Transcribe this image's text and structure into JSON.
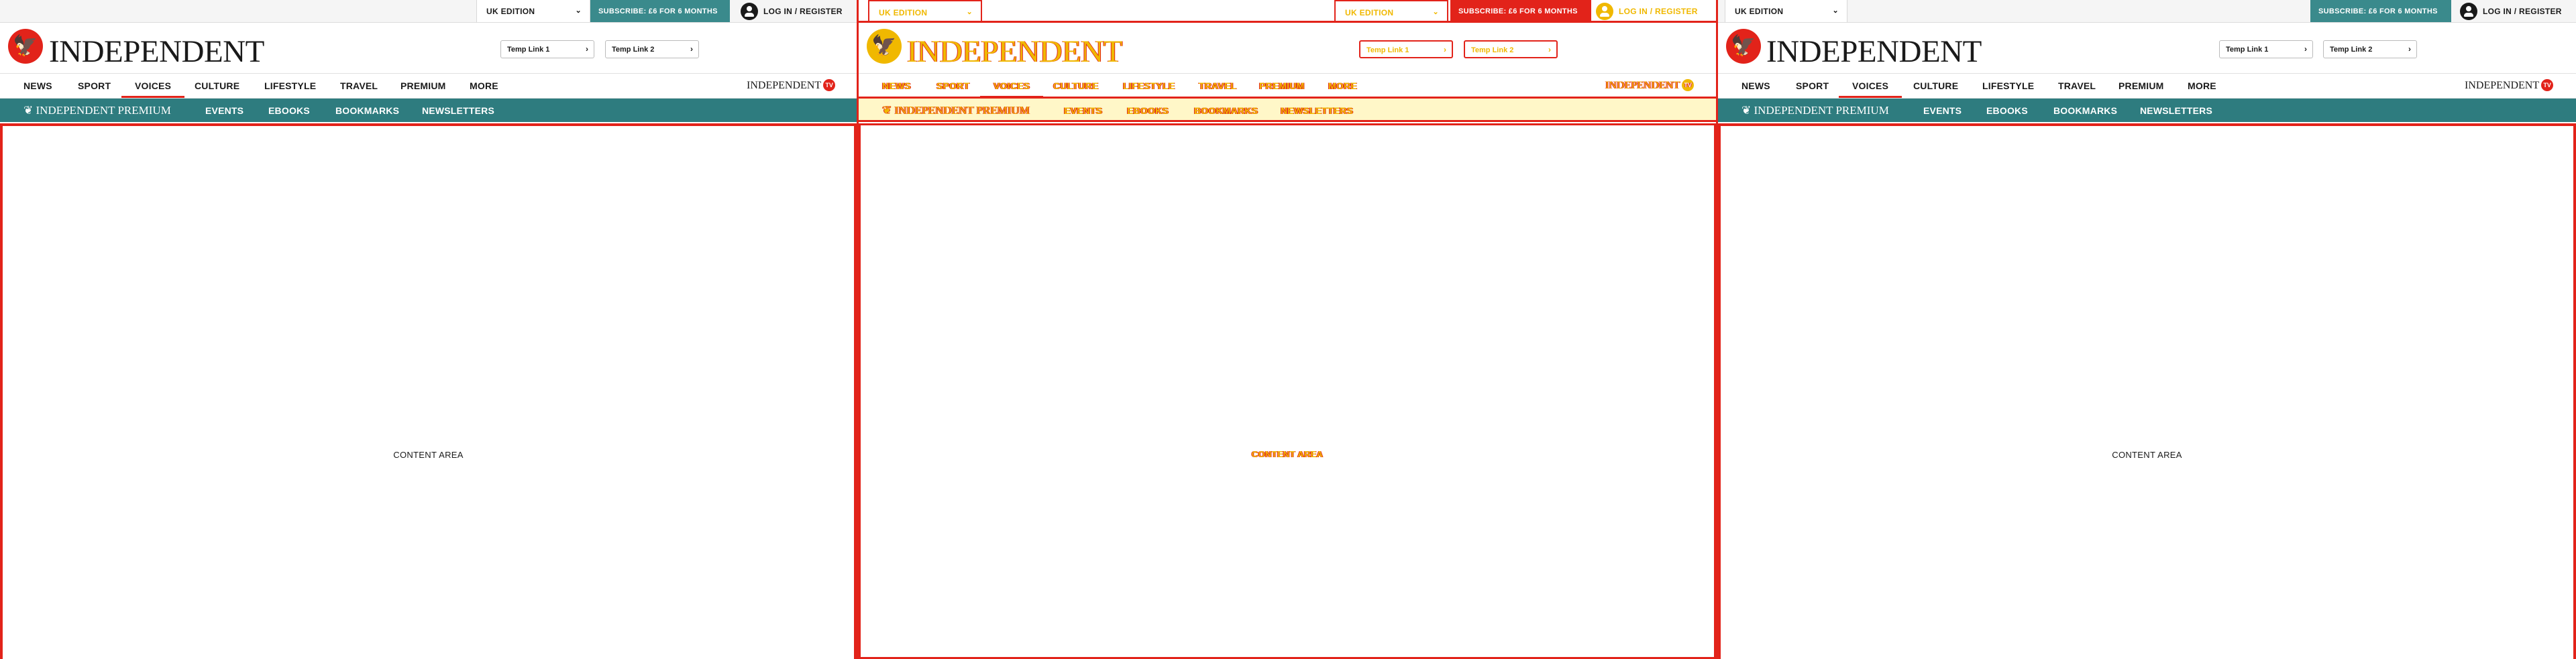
{
  "topbar": {
    "edition": "UK EDITION",
    "subscribe": "SUBSCRIBE: £6 FOR 6 MONTHS",
    "login": "LOG IN / REGISTER"
  },
  "masthead": {
    "wordmark": "INDEPENDENT",
    "temp_link_1": "Temp Link 1",
    "temp_link_2": "Temp Link 2"
  },
  "nav": {
    "items": [
      "NEWS",
      "SPORT",
      "VOICES",
      "CULTURE",
      "LIFESTYLE",
      "TRAVEL",
      "PREMIUM",
      "MORE"
    ],
    "active": "VOICES",
    "tv_logo": "INDEPENDENT",
    "tv_badge": "TV"
  },
  "premium_bar": {
    "logo": "INDEPENDENT PREMIUM",
    "items": [
      "EVENTS",
      "EBOOKS",
      "BOOKMARKS",
      "NEWSLETTERS"
    ]
  },
  "content": {
    "label": "CONTENT AREA"
  },
  "colors": {
    "brand_red": "#e2231a",
    "teal": "#3a8a8c",
    "premium_teal": "#2e7c7f",
    "yellow": "#f0b800"
  }
}
